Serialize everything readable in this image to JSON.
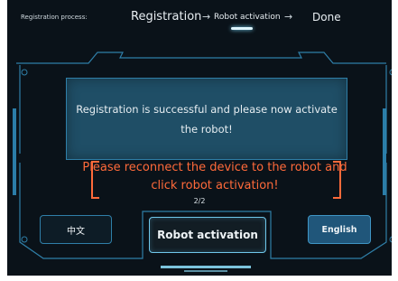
{
  "process": {
    "label": "Registration process:",
    "step1": "Registration",
    "arrow1": "→",
    "step2": "Robot activation",
    "arrow2": "→",
    "step3": "Done"
  },
  "message": "Registration is successful and please now activate the robot!",
  "warning": "Please reconnect the device to the robot and click robot activation!",
  "page_indicator": "2/2",
  "buttons": {
    "chinese": "中文",
    "activate": "Robot activation",
    "english": "English"
  },
  "colors": {
    "background": "#0a1219",
    "frame": "#2f7fa8",
    "warning": "#ff6a3a",
    "message_box": "#1f4e66"
  }
}
